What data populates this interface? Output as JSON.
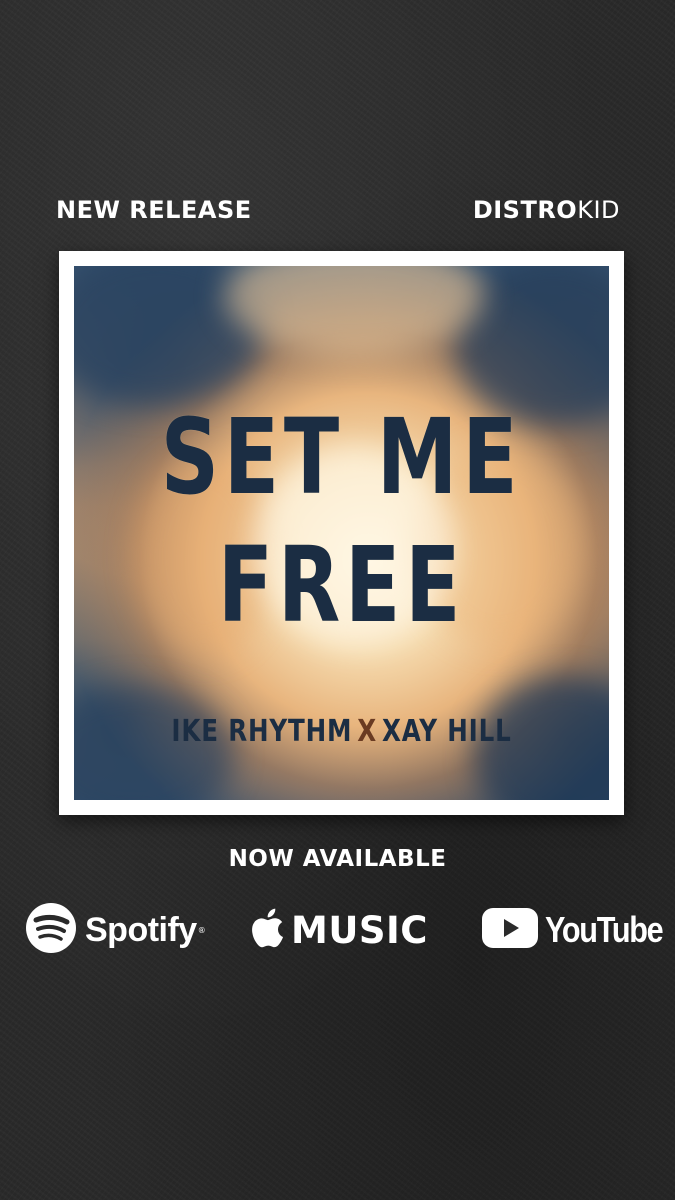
{
  "header": {
    "left_label": "NEW RELEASE",
    "brand_bold": "DISTRO",
    "brand_thin": "KID"
  },
  "cover": {
    "title_line_1": "SET ME",
    "title_line_2": "FREE",
    "artist_1": "IKE RHYTHM",
    "separator": "X",
    "artist_2": "XAY HILL"
  },
  "availability": {
    "label": "NOW AVAILABLE"
  },
  "platforms": {
    "spotify": {
      "name": "Spotify",
      "icon": "spotify-icon",
      "mark": "®"
    },
    "apple": {
      "name": "MUSIC",
      "icon": "apple-icon"
    },
    "youtube": {
      "name": "YouTube",
      "icon": "youtube-play-icon"
    }
  },
  "colors": {
    "background": "#2a2a2a",
    "cover_text": "#1b2d43",
    "text": "#ffffff"
  }
}
